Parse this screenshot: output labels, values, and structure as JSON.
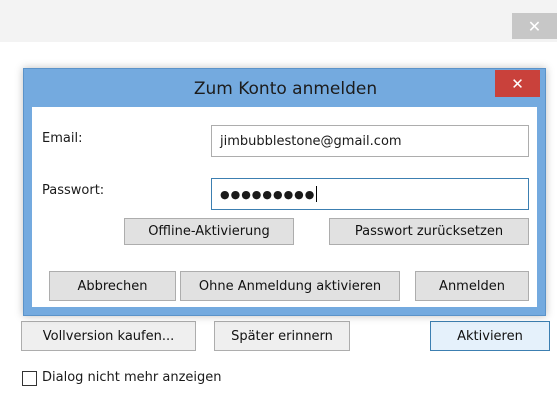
{
  "outer_window": {
    "close_glyph": "✕",
    "buttons": {
      "buy_full": "Vollversion kaufen...",
      "remind_later": "Später erinnern",
      "activate": "Aktivieren"
    },
    "dont_show_again_label": "Dialog nicht mehr anzeigen",
    "dont_show_again_checked": false
  },
  "login_dialog": {
    "title": "Zum Konto anmelden",
    "close_glyph": "✕",
    "email_label": "Email:",
    "email_value": "jimbubblestone@gmail.com",
    "password_label": "Passwort:",
    "password_masked": "●●●●●●●●●",
    "buttons": {
      "offline_activation": "Offline-Aktivierung",
      "reset_password": "Passwort zurücksetzen",
      "cancel": "Abbrechen",
      "activate_without_login": "Ohne Anmeldung aktivieren",
      "login": "Anmelden"
    }
  },
  "colors": {
    "dialog_frame": "#74aadf",
    "close_button": "#c9413b",
    "primary_button_bg": "#e5f1fb"
  }
}
